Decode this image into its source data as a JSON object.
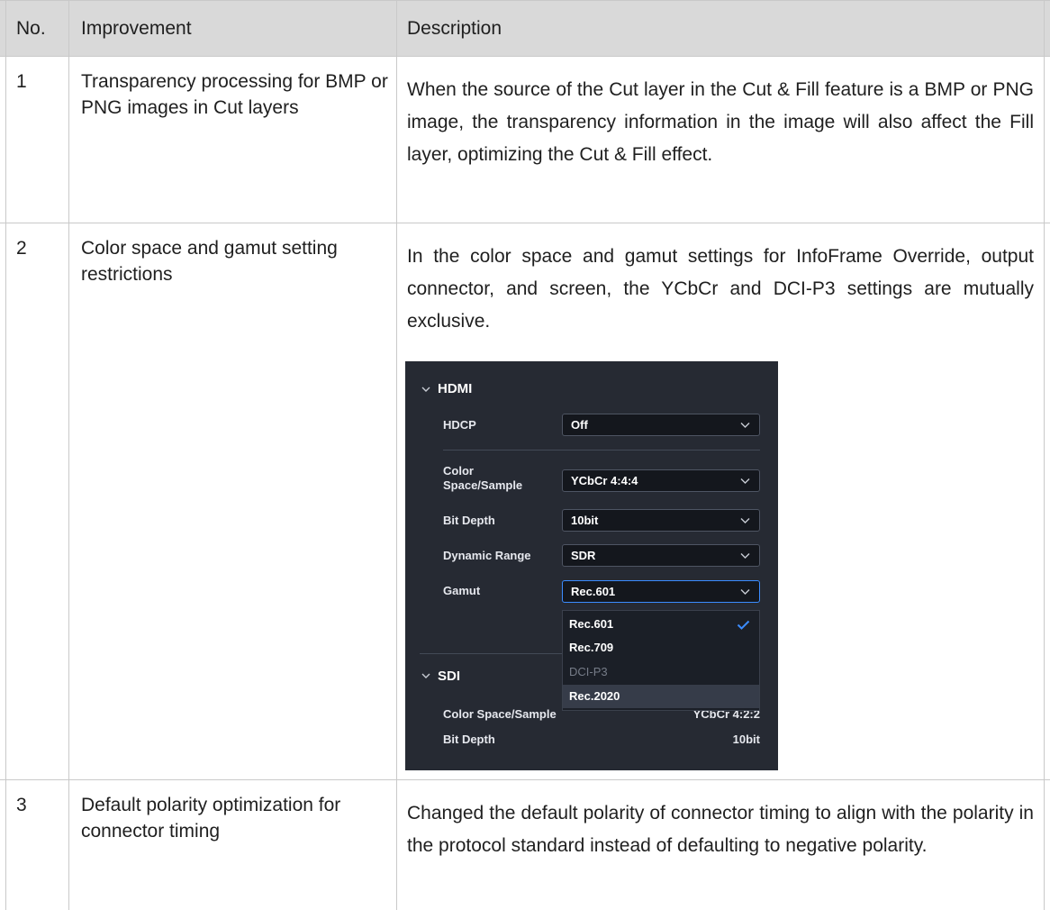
{
  "table": {
    "headers": {
      "no": "No.",
      "improvement": "Improvement",
      "description": "Description"
    },
    "rows": [
      {
        "no": "1",
        "improvement": "Transparency processing for BMP or PNG images in Cut layers",
        "description": "When the source of the Cut layer in the Cut & Fill feature is a BMP or PNG image, the transparency information in the image will also affect the Fill layer, optimizing the Cut & Fill effect."
      },
      {
        "no": "2",
        "improvement": "Color space and gamut setting restrictions",
        "description": "In the color space and gamut settings for InfoFrame Override, output connector, and screen, the YCbCr and DCI-P3 settings are mutually exclusive."
      },
      {
        "no": "3",
        "improvement": "Default polarity optimization for connector timing",
        "description": "Changed the default polarity of connector timing to align with the polarity in the protocol standard instead of defaulting to negative polarity."
      }
    ]
  },
  "screenshot": {
    "hdmi": {
      "title": "HDMI",
      "hdcp_label": "HDCP",
      "hdcp_value": "Off",
      "color_space_label": "Color Space/Sample",
      "color_space_value": "YCbCr 4:4:4",
      "bit_depth_label": "Bit Depth",
      "bit_depth_value": "10bit",
      "dynamic_range_label": "Dynamic Range",
      "dynamic_range_value": "SDR",
      "gamut_label": "Gamut",
      "gamut_value": "Rec.601",
      "gamut_options": [
        {
          "label": "Rec.601",
          "state": "selected"
        },
        {
          "label": "Rec.709",
          "state": "normal"
        },
        {
          "label": "DCI-P3",
          "state": "disabled"
        },
        {
          "label": "Rec.2020",
          "state": "hover"
        }
      ]
    },
    "sdi": {
      "title": "SDI",
      "color_space_label": "Color Space/Sample",
      "color_space_value": "YCbCr 4:2:2",
      "bit_depth_label": "Bit Depth",
      "bit_depth_value": "10bit"
    },
    "colors": {
      "background": "#262a33",
      "field": "#14171d",
      "accent": "#3b8cff",
      "disabled": "#767c88"
    },
    "icons": [
      "chevron-down-icon",
      "checkmark-icon"
    ]
  }
}
